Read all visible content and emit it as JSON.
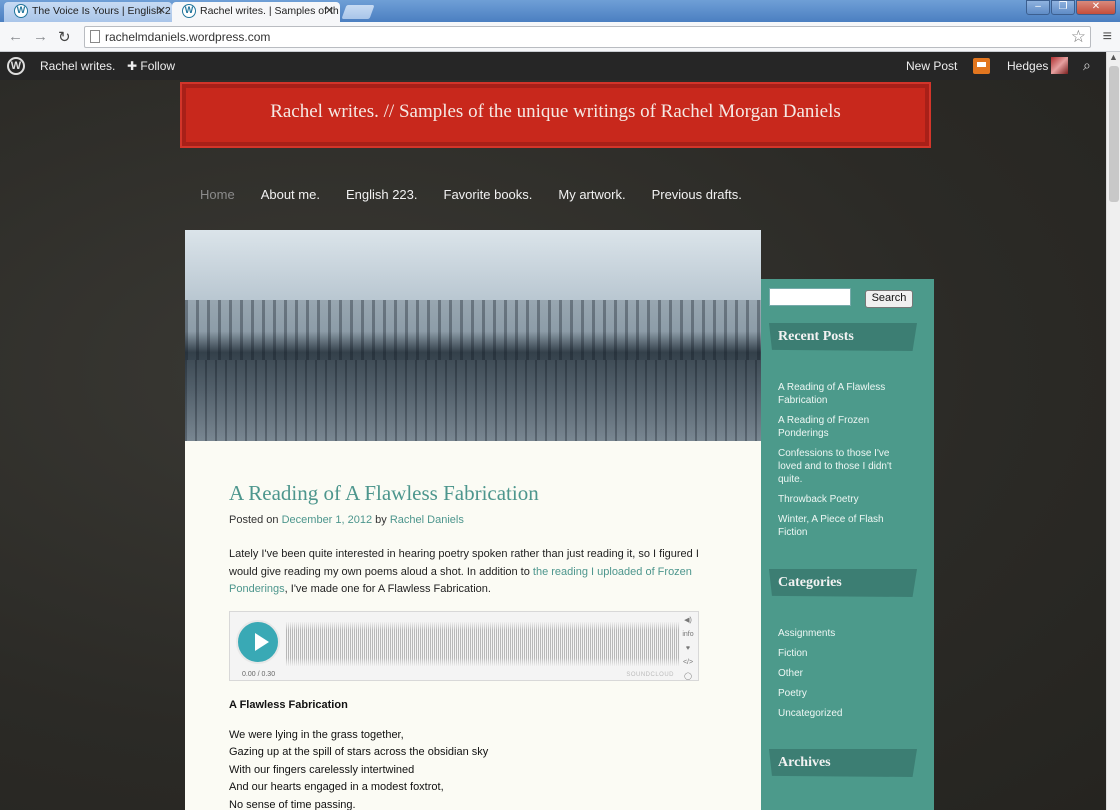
{
  "browser": {
    "tabs": [
      {
        "title": "The Voice Is Yours | English 2",
        "active": false
      },
      {
        "title": "Rachel writes. | Samples of th",
        "active": true
      }
    ],
    "url": "rachelmdaniels.wordpress.com"
  },
  "admin_bar": {
    "site_name": "Rachel writes.",
    "follow": "Follow",
    "new_post": "New Post",
    "user": "Hedges"
  },
  "site": {
    "banner_text": "Rachel writes.  //  Samples of the unique writings of Rachel Morgan Daniels",
    "nav": [
      "Home",
      "About me.",
      "English 223.",
      "Favorite books.",
      "My artwork.",
      "Previous drafts."
    ]
  },
  "post": {
    "title": "A Reading of A Flawless Fabrication",
    "meta_prefix": "Posted on",
    "date": "December 1, 2012",
    "by": "by",
    "author": "Rachel Daniels",
    "intro_before": "Lately I've been quite interested in hearing poetry spoken rather than just reading it, so I figured I would give reading my own poems aloud a shot. In addition to",
    "intro_link": "the reading I uploaded of Frozen Ponderings",
    "intro_after": ", I've made one for A Flawless Fabrication.",
    "player": {
      "time": "0.00 / 0.30",
      "brand": "SOUNDCLOUD",
      "side_info": "info"
    },
    "poem_title": "A Flawless Fabrication",
    "poem_lines": [
      "We were lying in the grass together,",
      "Gazing up at the spill of stars across the obsidian sky",
      "With our fingers carelessly intertwined",
      "And our hearts engaged in a modest foxtrot,",
      "No sense of time passing."
    ]
  },
  "sidebar": {
    "search_button": "Search",
    "search_value": "",
    "recent_title": "Recent Posts",
    "recent_posts": [
      "A Reading of A Flawless Fabrication",
      "A Reading of Frozen Ponderings",
      "Confessions to those I've loved and to those I didn't quite.",
      "Throwback Poetry",
      "Winter, A Piece of Flash Fiction"
    ],
    "categories_title": "Categories",
    "categories": [
      "Assignments",
      "Fiction",
      "Other",
      "Poetry",
      "Uncategorized"
    ],
    "archives_title": "Archives"
  }
}
